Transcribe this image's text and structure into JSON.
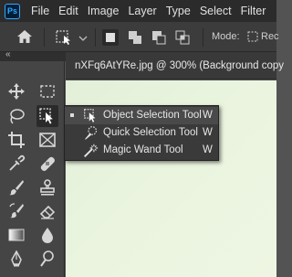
{
  "app": {
    "logo": "Ps"
  },
  "menubar": {
    "items": [
      "File",
      "Edit",
      "Image",
      "Layer",
      "Type",
      "Select",
      "Filter"
    ]
  },
  "options": {
    "home_icon": "home-icon",
    "mode_label": "Mode:",
    "mode_value": "Rec"
  },
  "toolbar": {
    "collapse_label": "«"
  },
  "document": {
    "tab_title": "nXFq6AtYRe.jpg @ 300% (Background copy"
  },
  "flyout": {
    "items": [
      {
        "label": "Object Selection Tool",
        "shortcut": "W",
        "icon": "object-selection-icon",
        "selected": true
      },
      {
        "label": "Quick Selection Tool",
        "shortcut": "W",
        "icon": "quick-selection-icon",
        "selected": false
      },
      {
        "label": "Magic Wand Tool",
        "shortcut": "W",
        "icon": "magic-wand-icon",
        "selected": false
      }
    ]
  },
  "colors": {
    "menubar_bg": "#2b2b2b",
    "toolbar_bg": "#454545",
    "canvas": "#e9f4de",
    "accent": "#31a8ff"
  }
}
